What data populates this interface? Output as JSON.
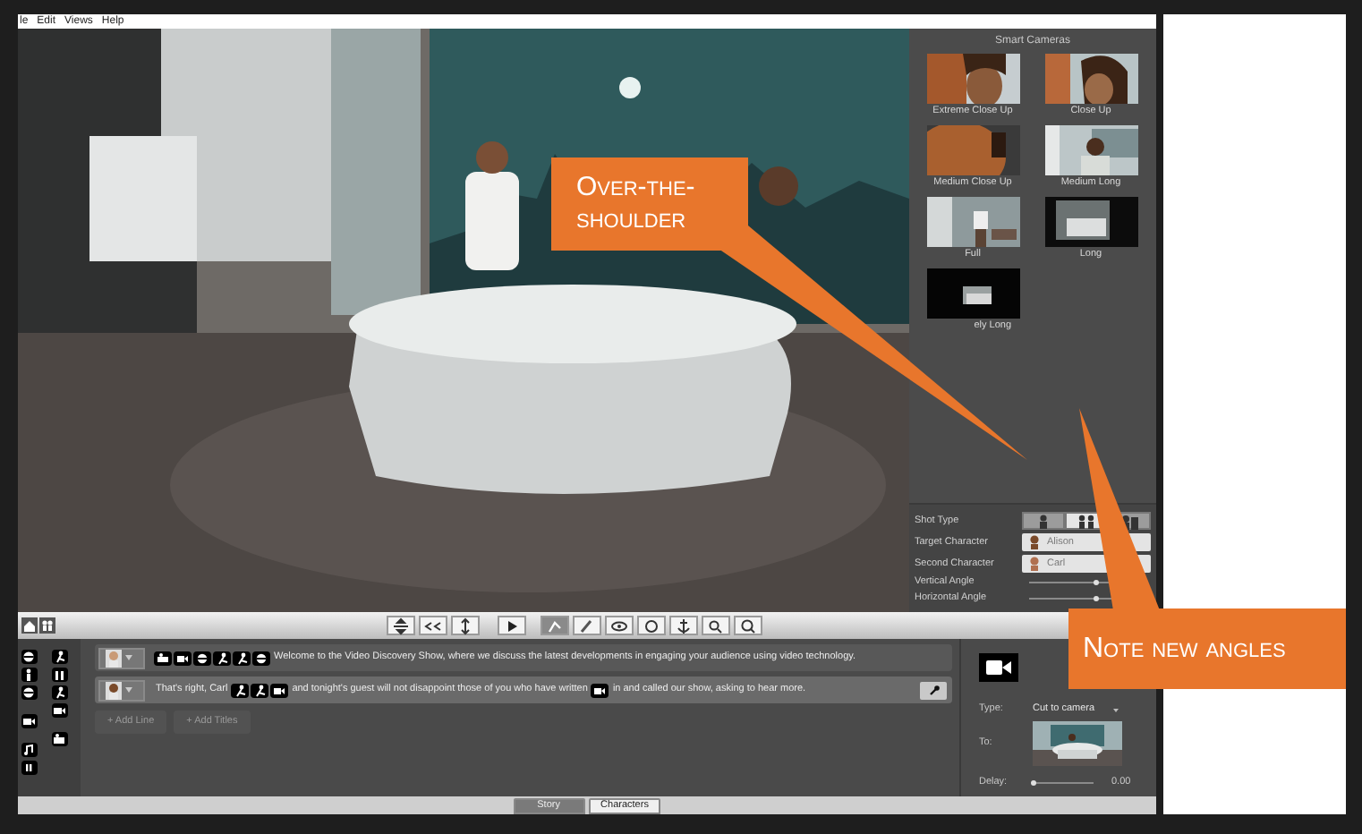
{
  "menu": [
    "le",
    "Edit",
    "Views",
    "Help"
  ],
  "smart_cameras": {
    "title": "Smart Cameras",
    "shots": [
      {
        "label": "Extreme Close Up"
      },
      {
        "label": "Close Up"
      },
      {
        "label": "Medium Close Up"
      },
      {
        "label": "Medium Long"
      },
      {
        "label": "Full"
      },
      {
        "label": "Long"
      },
      {
        "label": "ely Long"
      }
    ]
  },
  "shot_type": {
    "label": "Shot Type",
    "options": [
      {
        "selected": false
      },
      {
        "selected": true
      },
      {
        "selected": false
      }
    ]
  },
  "target_character": {
    "label": "Target Character",
    "value": "Alison"
  },
  "second_character": {
    "label": "Second Character",
    "value": "Carl"
  },
  "angles": [
    {
      "label": "Vertical Angle",
      "level": 0.62
    },
    {
      "label": "Horizontal Angle",
      "level": 0.62
    }
  ],
  "script_lines": [
    {
      "selected": false,
      "segments": [
        {
          "kind": "action"
        },
        {
          "kind": "action"
        },
        {
          "kind": "action"
        },
        {
          "kind": "action"
        },
        {
          "kind": "action"
        },
        {
          "kind": "action"
        },
        {
          "kind": "text",
          "text": "Welcome to the Video Discovery Show, where we discuss the latest developments in engaging your audience using video technology."
        }
      ]
    },
    {
      "selected": true,
      "segments": [
        {
          "kind": "text",
          "text": "That's right, Carl"
        },
        {
          "kind": "action"
        },
        {
          "kind": "action"
        },
        {
          "kind": "action"
        },
        {
          "kind": "text",
          "text": "and tonight's guest will not disappoint those of you who have written"
        },
        {
          "kind": "action"
        },
        {
          "kind": "text",
          "text": "in and called our show, asking to hear more."
        }
      ]
    }
  ],
  "add_buttons": [
    "+ Add Line",
    "+ Add Titles"
  ],
  "transition": {
    "type_label": "Type:",
    "type_value": "Cut to camera",
    "to_label": "To:",
    "delay": {
      "label": "Delay:",
      "level": 0.0,
      "reading": "0.00"
    }
  },
  "bottom_tabs": [
    {
      "label": "Story",
      "selected": true
    },
    {
      "label": "Characters",
      "selected": false
    }
  ],
  "callouts": [
    "Over-the-shoulder",
    "Note new angles"
  ]
}
